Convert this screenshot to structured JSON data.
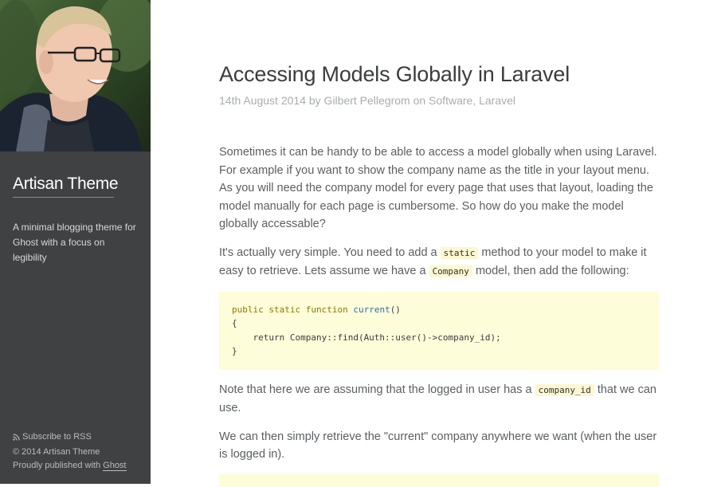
{
  "sidebar": {
    "site_title": "Artisan Theme",
    "site_description": "A minimal blogging theme for Ghost with a focus on legibility",
    "footer": {
      "rss_label": "Subscribe to RSS",
      "copyright": "© 2014 Artisan Theme",
      "published_prefix": "Proudly published with",
      "ghost_link": "Ghost"
    }
  },
  "post": {
    "title": "Accessing Models Globally in Laravel",
    "meta": "14th August 2014 by Gilbert Pellegrom on Software, Laravel",
    "paragraph1": "Sometimes it can be handy to be able to access a model globally when using Laravel. For example if you want to show the company name as the title in your layout menu. As you will need the company model for every page that uses that layout, loading the model manually for each page is cumbersome. So how do you make the model globally accessable?",
    "paragraph2": {
      "part1": "It's actually very simple. You need to add a ",
      "code1": "static",
      "part2": " method to your model to make it easy to retrieve. Lets assume we have a ",
      "code2": "Company",
      "part3": " model, then add the following:"
    },
    "code_block": {
      "line1_kw": "public static function ",
      "line1_fn": "current",
      "line1_end": "()",
      "line2": "{",
      "line3": "    return Company::find(Auth::user()->company_id);",
      "line4": "}"
    },
    "paragraph3": {
      "part1": "Note that here we are assuming that the logged in user has a ",
      "code1": "company_id",
      "part2": " that we can use."
    },
    "paragraph4": "We can then simply retrieve the \"current\" company anywhere we want (when the user is logged in)."
  }
}
